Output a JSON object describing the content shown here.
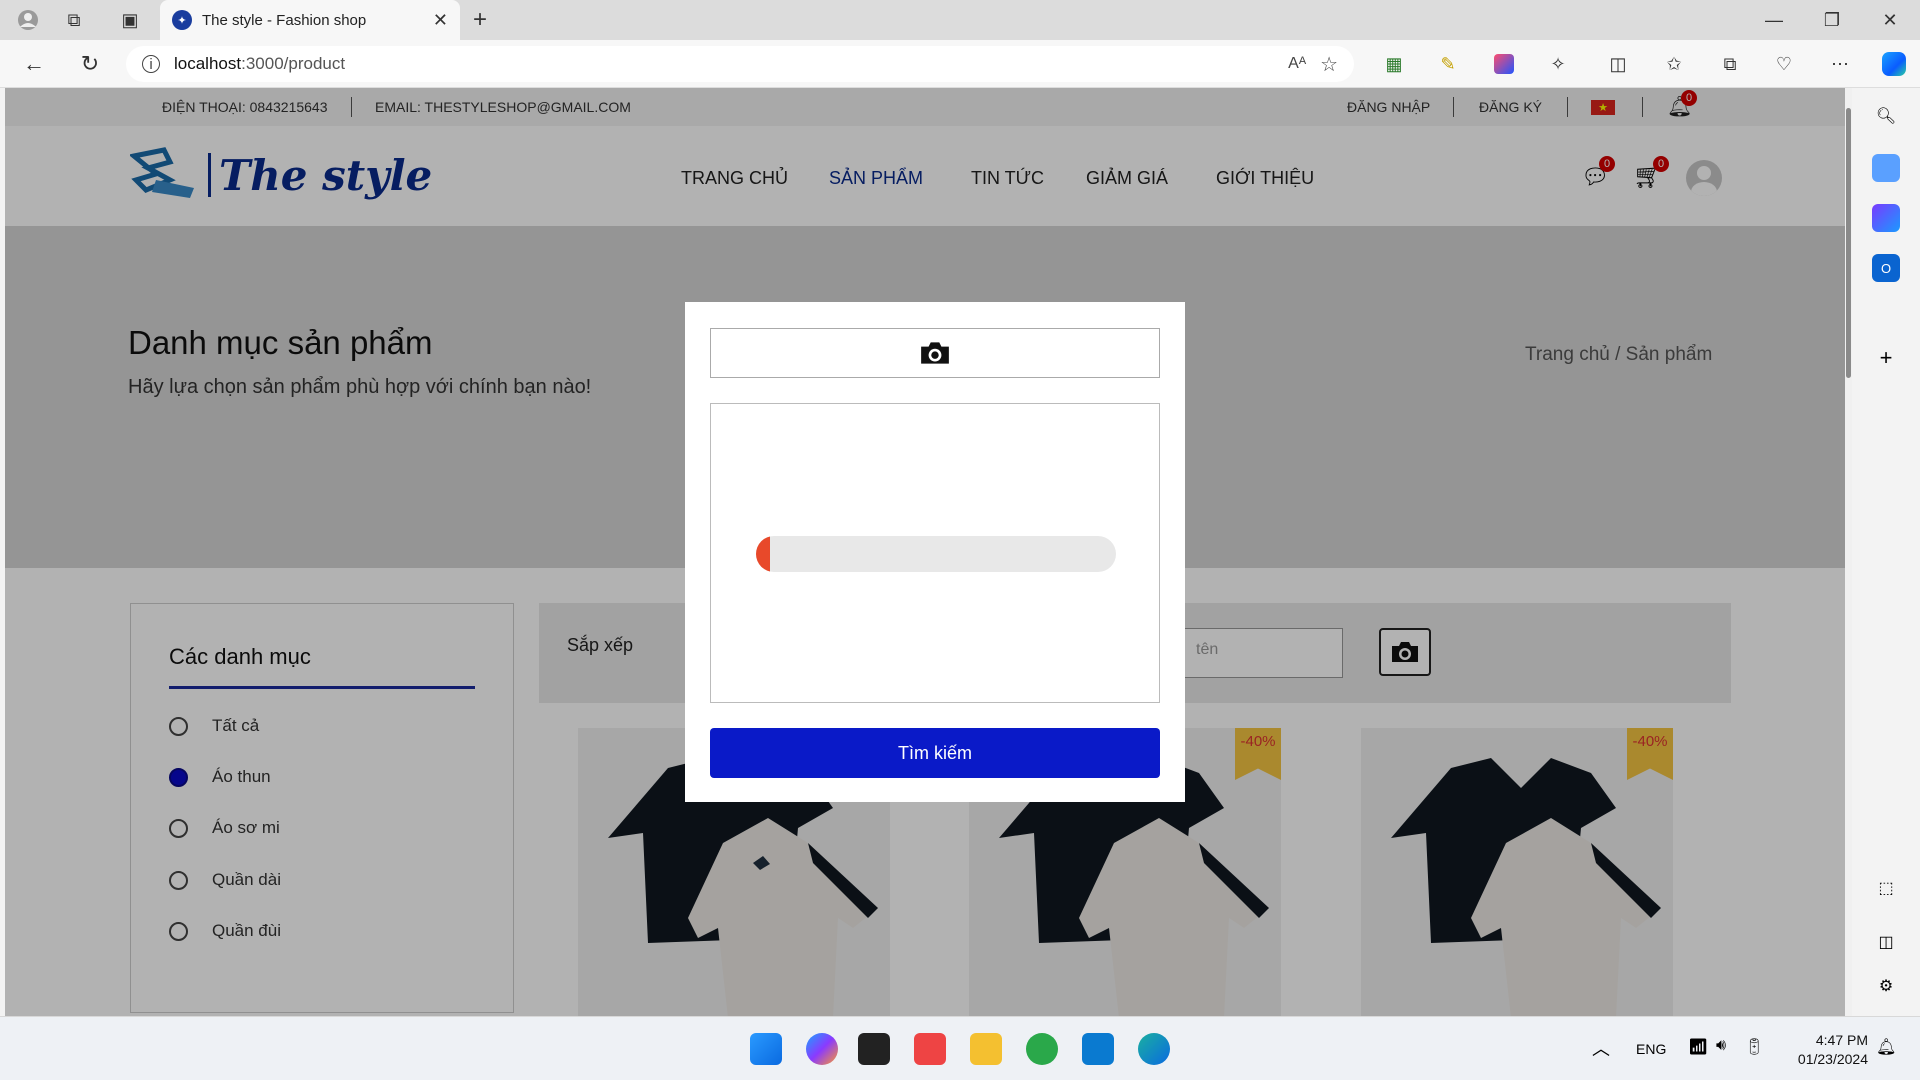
{
  "browser": {
    "tab_title": "The style - Fashion shop",
    "url_host": "localhost",
    "url_path": ":3000/product"
  },
  "site": {
    "topbar": {
      "phone": "ĐIỆN THOẠI: 0843215643",
      "email": "EMAIL: THESTYLESHOP@GMAIL.COM",
      "login": "ĐĂNG NHẬP",
      "register": "ĐĂNG KÝ",
      "notif_count": "0"
    },
    "logo_text": "The style",
    "nav": [
      {
        "label": "TRANG CHỦ"
      },
      {
        "label": "SẢN PHẨM"
      },
      {
        "label": "TIN TỨC"
      },
      {
        "label": "GIẢM GIÁ"
      },
      {
        "label": "GIỚI THIỆU"
      }
    ],
    "chat_count": "0",
    "cart_count": "0",
    "hero": {
      "title": "Danh mục sản phẩm",
      "subtitle": "Hãy lựa chọn sản phẩm phù hợp với chính bạn nào!",
      "breadcrumb": "Trang chủ  /  Sản phẩm"
    },
    "categories": {
      "title": "Các danh mục",
      "items": [
        {
          "label": "Tất cả",
          "selected": false
        },
        {
          "label": "Áo thun",
          "selected": true
        },
        {
          "label": "Áo sơ mi",
          "selected": false
        },
        {
          "label": "Quần dài",
          "selected": false
        },
        {
          "label": "Quần đùi",
          "selected": false
        }
      ]
    },
    "filter": {
      "sort_label": "Sắp xếp",
      "search_placeholder": "tên"
    },
    "products": [
      {
        "discount": ""
      },
      {
        "discount": "-40%"
      },
      {
        "discount": "-40%"
      }
    ]
  },
  "modal": {
    "progress": 0.04,
    "progress_color": "#e8492a",
    "search_button": "Tìm kiếm"
  },
  "taskbar": {
    "lang": "ENG",
    "time": "4:47 PM",
    "date": "01/23/2024"
  },
  "colors": {
    "brand": "#0a2a8c",
    "primary_button": "#0a1ac8"
  }
}
